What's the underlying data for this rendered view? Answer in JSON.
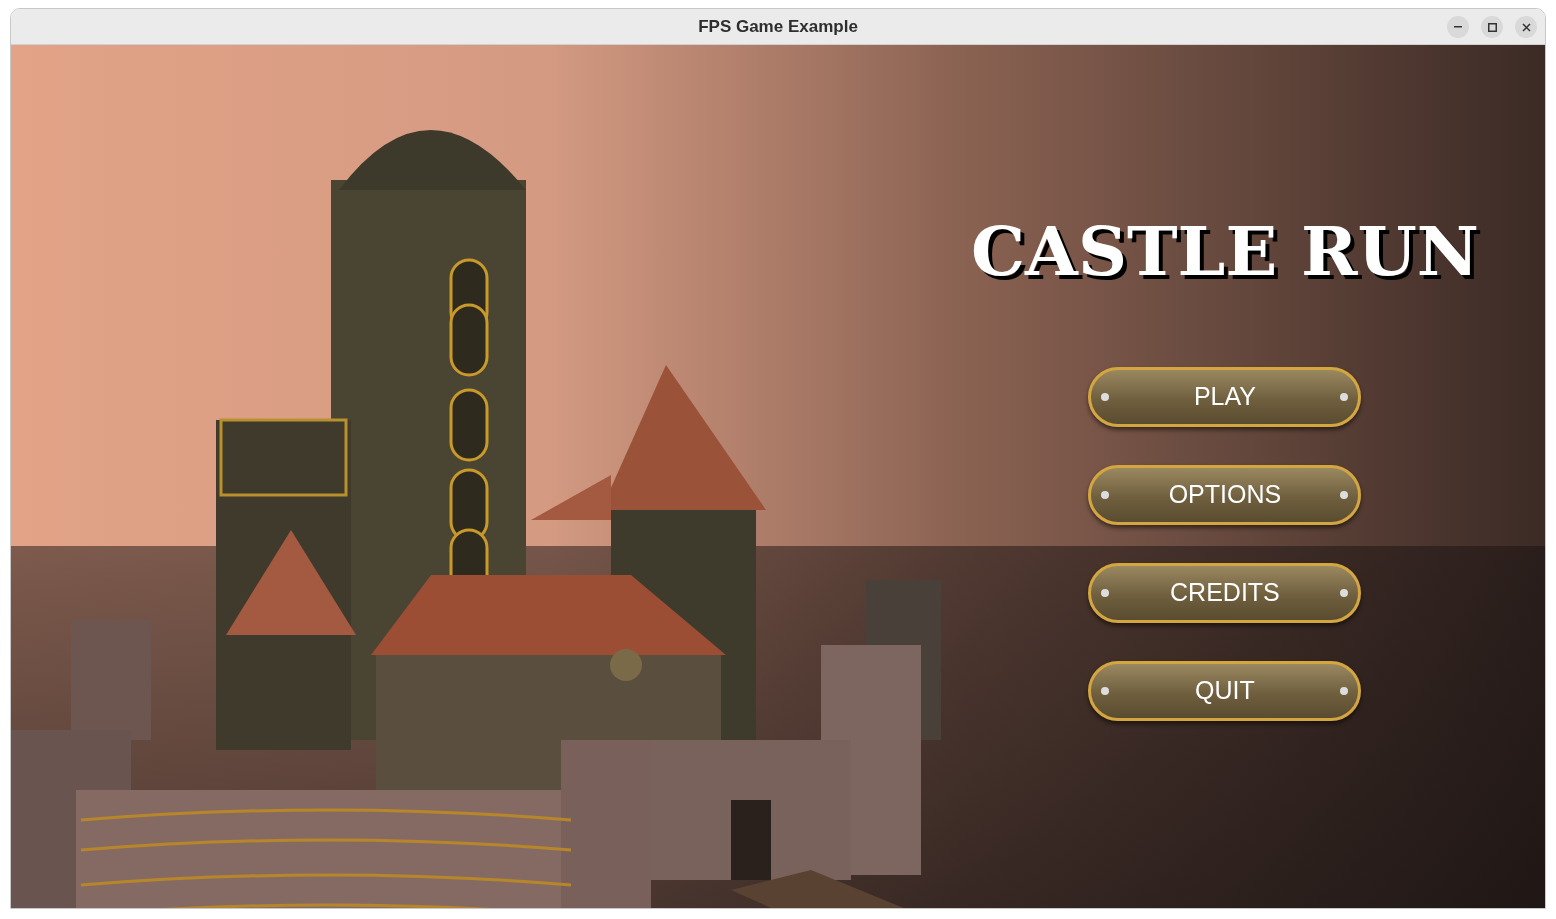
{
  "window": {
    "title": "FPS Game Example"
  },
  "game": {
    "title": "CASTLE RUN",
    "menu": [
      {
        "label": "PLAY"
      },
      {
        "label": "OPTIONS"
      },
      {
        "label": "CREDITS"
      },
      {
        "label": "QUIT"
      }
    ]
  }
}
